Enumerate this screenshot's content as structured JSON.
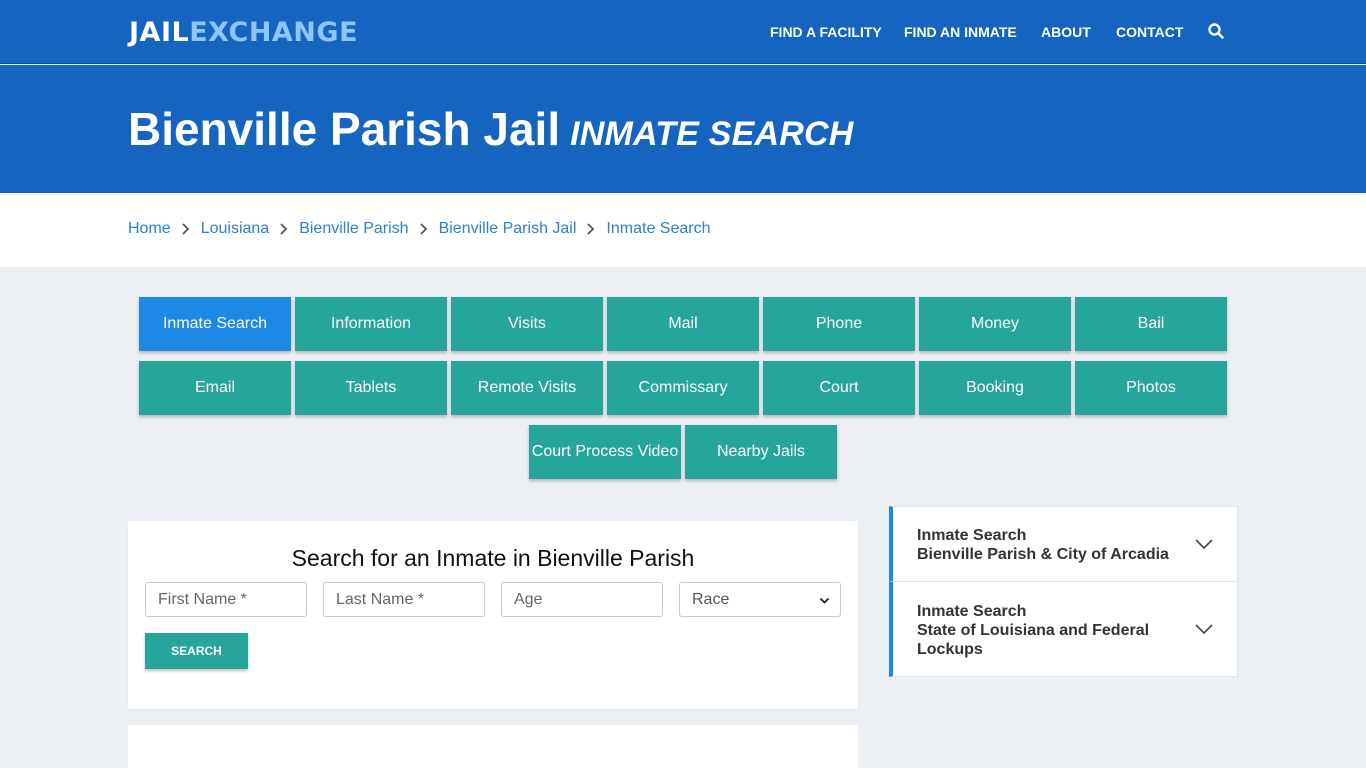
{
  "brand": {
    "part1": "JAIL",
    "part2": "EXCHANGE"
  },
  "nav": {
    "items": [
      "FIND A FACILITY",
      "FIND AN INMATE",
      "ABOUT",
      "CONTACT"
    ],
    "search_icon": "search-icon"
  },
  "hero": {
    "title": "Bienville Parish Jail",
    "subtitle": "INMATE SEARCH"
  },
  "breadcrumb": [
    "Home",
    "Louisiana",
    "Bienville Parish",
    "Bienville Parish Jail",
    "Inmate Search"
  ],
  "tabs": [
    "Inmate Search",
    "Information",
    "Visits",
    "Mail",
    "Phone",
    "Money",
    "Bail",
    "Email",
    "Tablets",
    "Remote Visits",
    "Commissary",
    "Court",
    "Booking",
    "Photos",
    "Court Process Video",
    "Nearby Jails"
  ],
  "active_tab": "Inmate Search",
  "search": {
    "heading": "Search for an Inmate in Bienville Parish",
    "first_name_placeholder": "First Name *",
    "last_name_placeholder": "Last Name *",
    "age_placeholder": "Age",
    "race_selected": "Race",
    "button": "SEARCH"
  },
  "sidebar": [
    {
      "line1": "Inmate Search",
      "line2": "Bienville Parish & City of Arcadia"
    },
    {
      "line1": "Inmate Search",
      "line2": "State of Louisiana and Federal Lockups"
    }
  ],
  "colors": {
    "nav_blue": "#1565c0",
    "teal": "#26a69a",
    "active_blue": "#1e88e5",
    "link": "#2f80c8"
  }
}
